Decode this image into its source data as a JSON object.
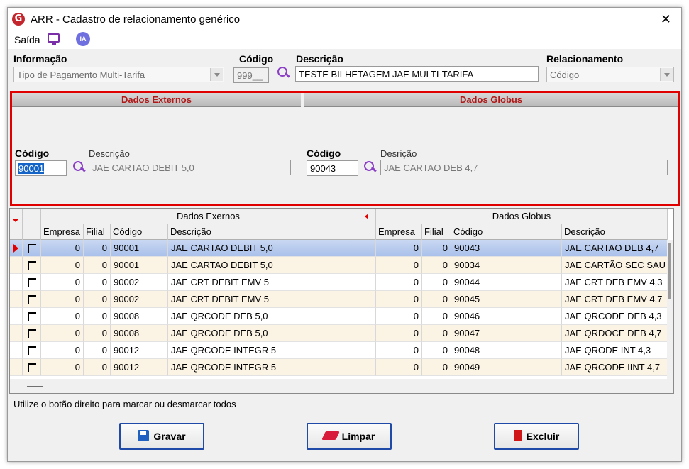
{
  "window": {
    "title": "ARR - Cadastro de relacionamento genérico",
    "logo_letter": "G",
    "close_glyph": "✕"
  },
  "toolbar": {
    "saida_label": "Saída",
    "ia_label": "IA"
  },
  "header": {
    "informacao_label": "Informação",
    "informacao_value": "Tipo de Pagamento Multi-Tarifa",
    "codigo_label": "Código",
    "codigo_value": "999__",
    "descricao_label": "Descrição",
    "descricao_value": "TESTE BILHETAGEM JAE MULTI-TARIFA",
    "relacionamento_label": "Relacionamento",
    "relacionamento_value": "Código"
  },
  "externos": {
    "title": "Dados Externos",
    "codigo_label": "Código",
    "codigo_value": "90001",
    "descricao_label": "Descrição",
    "descricao_value": "JAE CARTAO DEBIT 5,0"
  },
  "globus": {
    "title": "Dados Globus",
    "codigo_label": "Código",
    "codigo_value": "90043",
    "descricao_label": "Desrição",
    "descricao_value": "JAE CARTAO DEB 4,7"
  },
  "grid": {
    "group_left": "Dados Exernos",
    "group_right": "Dados Globus",
    "columns": [
      "Empresa",
      "Filial",
      "Código",
      "Descrição",
      "Empresa",
      "Filial",
      "Código",
      "Descrição"
    ],
    "rows": [
      [
        "0",
        "0",
        "90001",
        "JAE CARTAO DEBIT 5,0",
        "0",
        "0",
        "90043",
        "JAE CARTAO DEB 4,7"
      ],
      [
        "0",
        "0",
        "90001",
        "JAE CARTAO DEBIT 5,0",
        "0",
        "0",
        "90034",
        "JAE CARTÃO SEC SAU"
      ],
      [
        "0",
        "0",
        "90002",
        "JAE CRT DEBIT EMV 5",
        "0",
        "0",
        "90044",
        "JAE CRT DEB EMV 4,3"
      ],
      [
        "0",
        "0",
        "90002",
        "JAE CRT DEBIT EMV 5",
        "0",
        "0",
        "90045",
        "JAE CRT DEB EMV 4,7"
      ],
      [
        "0",
        "0",
        "90008",
        "JAE QRCODE DEB 5,0",
        "0",
        "0",
        "90046",
        "JAE QRCODE DEB 4,3"
      ],
      [
        "0",
        "0",
        "90008",
        "JAE QRCODE DEB 5,0",
        "0",
        "0",
        "90047",
        "JAE QRDOCE DEB 4,7"
      ],
      [
        "0",
        "0",
        "90012",
        "JAE QRCODE INTEGR 5",
        "0",
        "0",
        "90048",
        "JAE QRODE INT 4,3"
      ],
      [
        "0",
        "0",
        "90012",
        "JAE QRCODE INTEGR 5",
        "0",
        "0",
        "90049",
        "JAE QRCODE IINT 4,7"
      ]
    ]
  },
  "hint": "Utilize o botão direito para marcar ou desmarcar todos",
  "buttons": {
    "gravar_first": "G",
    "gravar_rest": "ravar",
    "limpar_first": "L",
    "limpar_rest": "impar",
    "excluir_first": "E",
    "excluir_rest": "xcluir"
  },
  "colors": {
    "highlight_frame": "#e00000",
    "panel_title": "#b01818",
    "button_border": "#1f4aa8"
  }
}
